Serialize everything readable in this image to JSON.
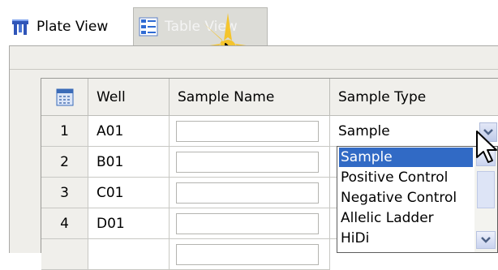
{
  "tabs": [
    {
      "label": "Plate View",
      "icon": "plate-view-icon"
    },
    {
      "label": "Table View",
      "icon": "table-view-icon",
      "selected": true
    }
  ],
  "table": {
    "columns": [
      "Well",
      "Sample Name",
      "Sample Type"
    ],
    "rows": [
      {
        "num": "1",
        "well": "A01",
        "sample_name": "",
        "sample_type": "Sample"
      },
      {
        "num": "2",
        "well": "B01",
        "sample_name": "",
        "sample_type": ""
      },
      {
        "num": "3",
        "well": "C01",
        "sample_name": "",
        "sample_type": ""
      },
      {
        "num": "4",
        "well": "D01",
        "sample_name": "",
        "sample_type": ""
      }
    ]
  },
  "sample_type_dropdown": {
    "options": [
      "Sample",
      "Positive Control",
      "Negative Control",
      "Allelic Ladder",
      "HiDi"
    ],
    "selected": "Sample"
  },
  "colors": {
    "selection": "#316ac5",
    "highlight_burst": "#f7c21b"
  }
}
